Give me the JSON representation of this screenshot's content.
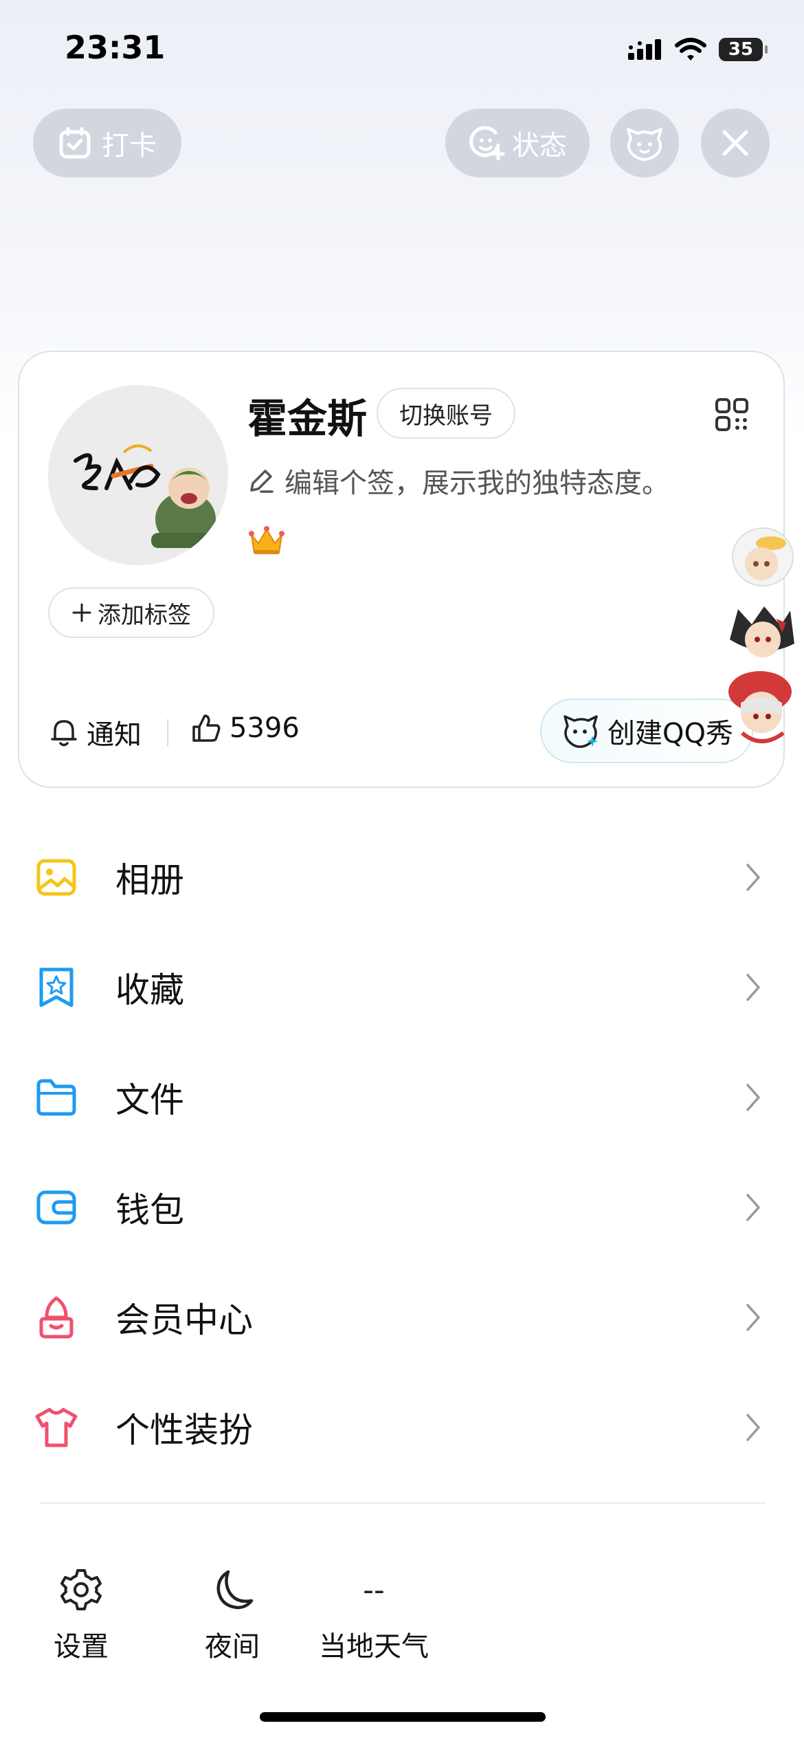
{
  "status_bar": {
    "time": "23:31",
    "battery": "35"
  },
  "top_bar": {
    "checkin_label": "打卡",
    "status_label": "状态"
  },
  "profile": {
    "username": "霍金斯",
    "switch_account": "切换账号",
    "signature": "编辑个签，展示我的独特态度。",
    "add_tag": "添加标签",
    "notify_label": "通知",
    "likes_count": "5396",
    "create_qq_show": "创建QQ秀"
  },
  "menu": {
    "items": [
      {
        "label": "相册",
        "icon": "photo-album-icon",
        "color": "#f5c518"
      },
      {
        "label": "收藏",
        "icon": "favorites-star-icon",
        "color": "#1e9bf0"
      },
      {
        "label": "文件",
        "icon": "folder-icon",
        "color": "#1e9bf0"
      },
      {
        "label": "钱包",
        "icon": "wallet-icon",
        "color": "#1e9bf0"
      },
      {
        "label": "会员中心",
        "icon": "vip-center-icon",
        "color": "#f0506e"
      },
      {
        "label": "个性装扮",
        "icon": "tshirt-icon",
        "color": "#f0506e"
      }
    ]
  },
  "bottom_bar": {
    "settings_label": "设置",
    "night_label": "夜间",
    "weather_value": "--",
    "weather_label": "当地天气"
  },
  "colors": {
    "accent_blue": "#1e9bf0",
    "accent_red": "#f0506e",
    "accent_yellow": "#f5c518"
  }
}
